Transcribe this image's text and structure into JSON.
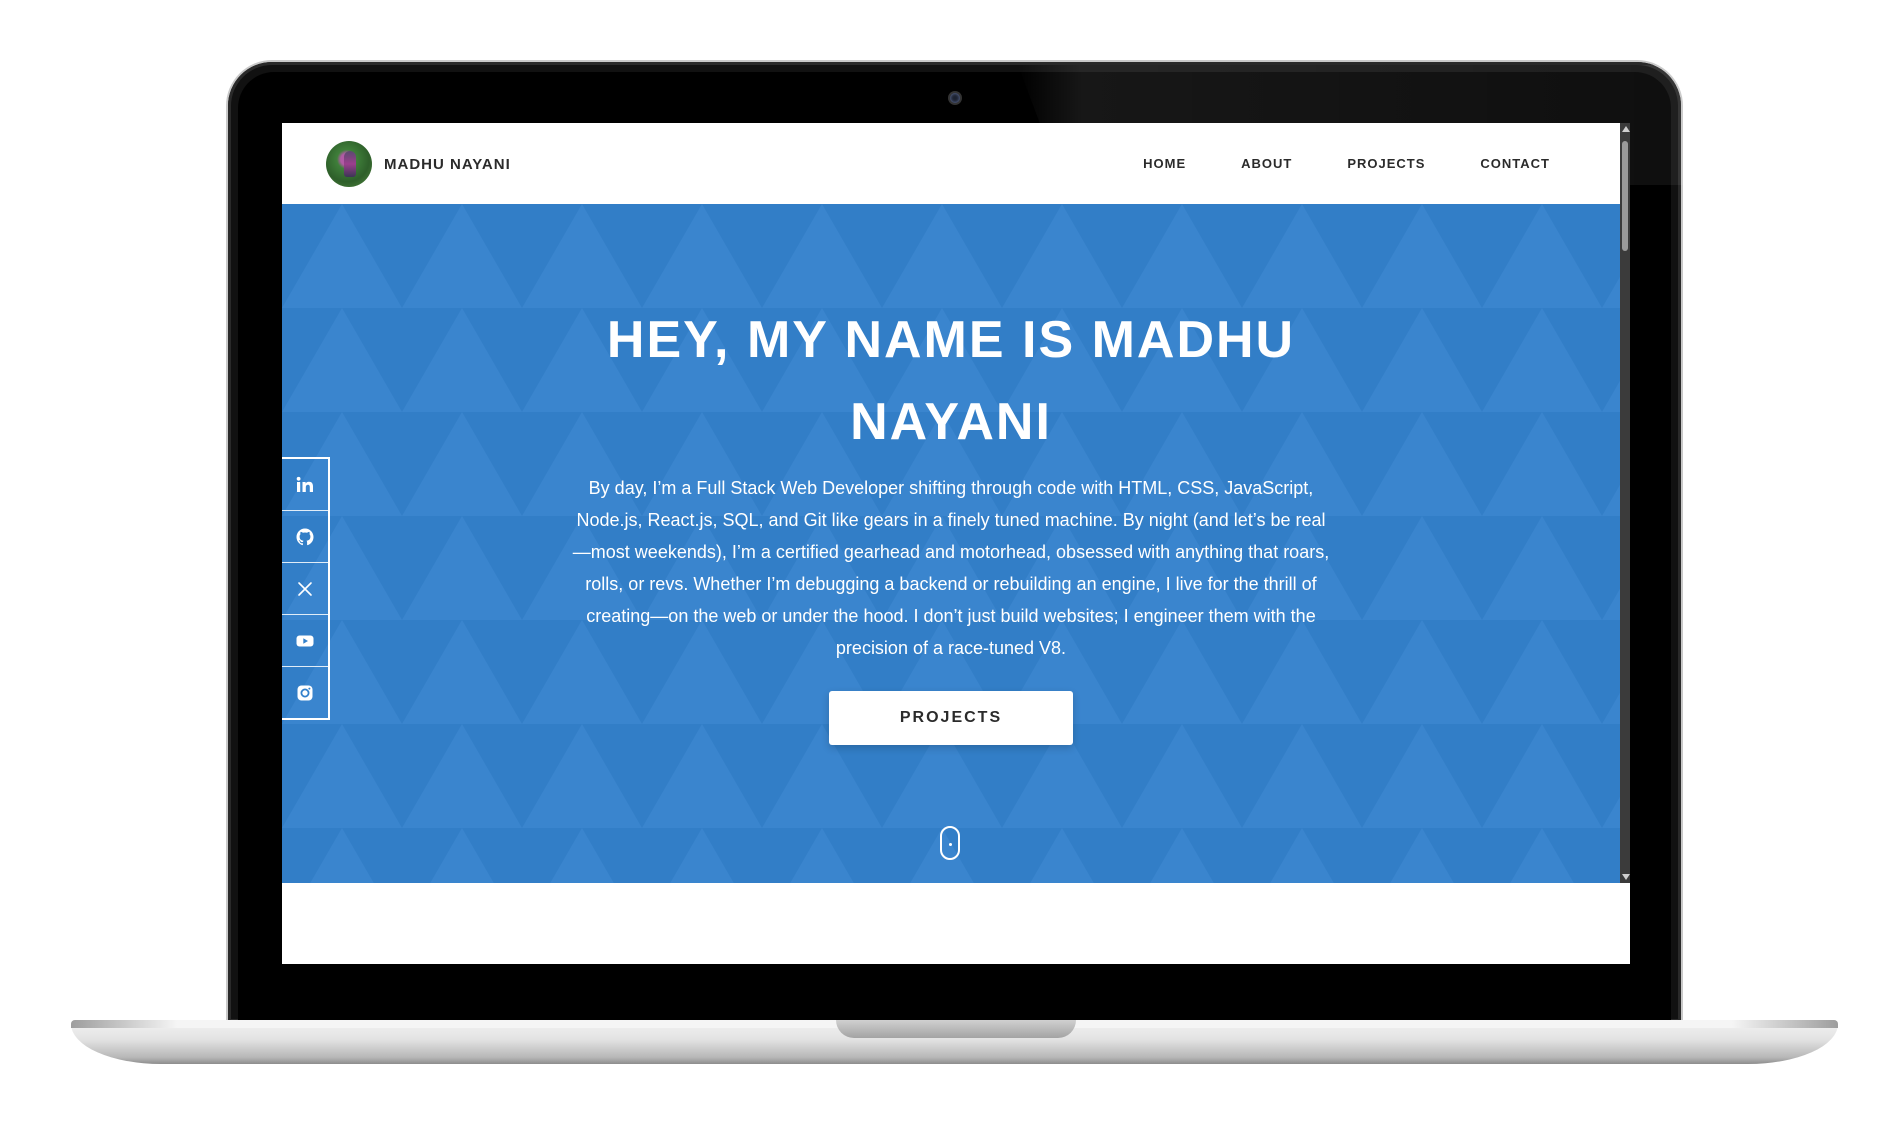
{
  "site": {
    "brand_name": "MADHU NAYANI"
  },
  "nav": {
    "items": [
      {
        "label": "HOME"
      },
      {
        "label": "ABOUT"
      },
      {
        "label": "PROJECTS"
      },
      {
        "label": "CONTACT"
      }
    ]
  },
  "hero": {
    "title": "HEY, MY NAME IS MADHU NAYANI",
    "description": "By day, I’m a Full Stack Web Developer shifting through code with HTML, CSS, JavaScript, Node.js, React.js, SQL, and Git like gears in a finely tuned machine. By night (and let’s be real—most weekends), I’m a certified gearhead and motorhead, obsessed with anything that roars, rolls, or revs. Whether I’m debugging a backend or rebuilding an engine, I live for the thrill of creating—on the web or under the hood. I don’t just build websites; I engineer them with the precision of a race-tuned V8.",
    "button_label": "PROJECTS"
  },
  "social": {
    "items": [
      {
        "icon": "linkedin-icon"
      },
      {
        "icon": "github-icon"
      },
      {
        "icon": "x-twitter-icon"
      },
      {
        "icon": "youtube-icon"
      },
      {
        "icon": "instagram-icon"
      }
    ]
  },
  "colors": {
    "hero_background": "#3381cc",
    "text_dark": "#2b2b2b",
    "white": "#ffffff"
  }
}
